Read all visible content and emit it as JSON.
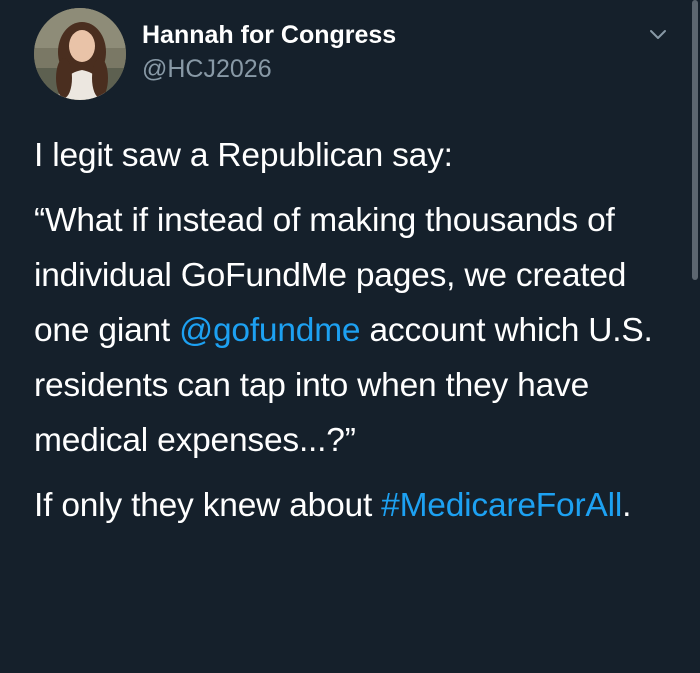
{
  "tweet": {
    "display_name": "Hannah for Congress",
    "handle": "@HCJ2026",
    "avatar_icon": "profile-photo",
    "menu_icon": "chevron-down-icon",
    "paragraph1": "I legit saw a Republican say:",
    "paragraph2": {
      "part1": "“What if instead of making thousands of individual GoFundMe pages, we created one giant ",
      "mention": "@gofundme",
      "part2": " account which U.S. residents can tap into when they have medical expenses...?”"
    },
    "paragraph3": {
      "part1": "If only they knew about ",
      "hashtag": "#MedicareForAll",
      "part2": "."
    }
  },
  "colors": {
    "background": "#15202b",
    "text": "#ffffff",
    "secondary_text": "#8899a6",
    "link": "#1da1f2"
  }
}
